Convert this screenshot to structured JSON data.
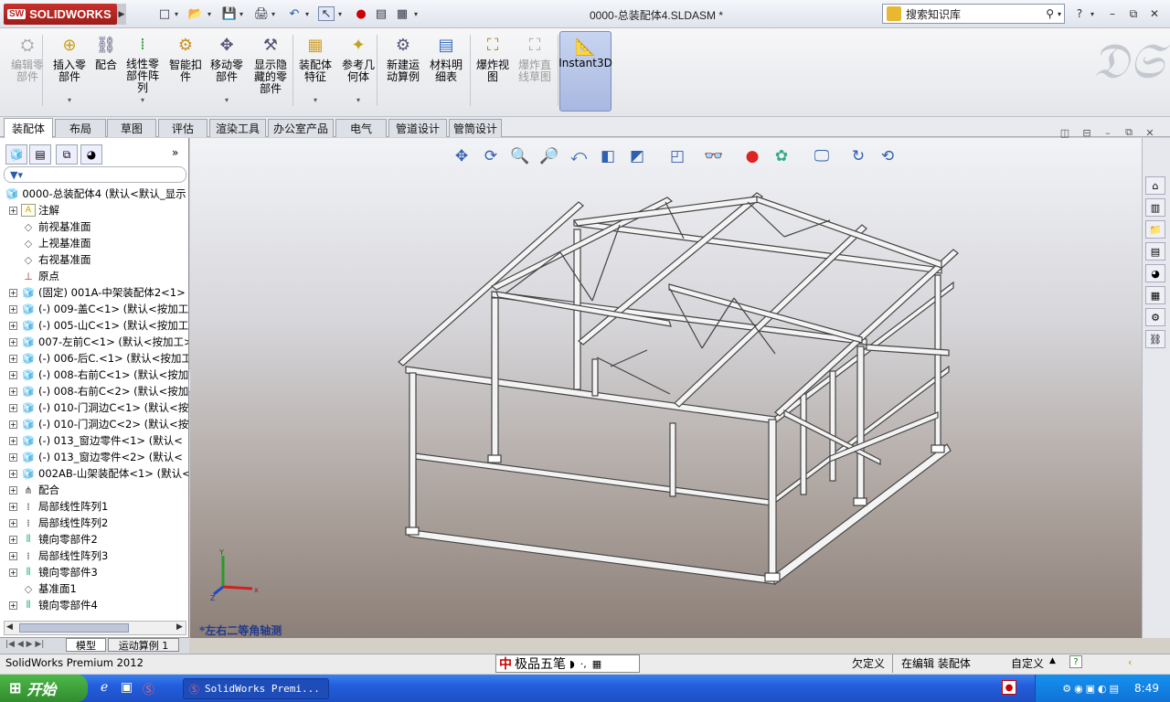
{
  "app": {
    "logo_text": "SOLIDWORKS",
    "logo_badge": "SW",
    "document_title": "0000-总装配体4.SLDASM *"
  },
  "search": {
    "placeholder": "搜索知识库"
  },
  "window_controls": {
    "help": "?",
    "minimize": "–",
    "restore": "⧉",
    "close": "✕"
  },
  "ribbon": {
    "buttons": [
      {
        "label": "编辑零\n部件",
        "enabled": false,
        "icon": "edit-component-icon"
      },
      {
        "label": "插入零\n部件",
        "enabled": true,
        "icon": "insert-component-icon"
      },
      {
        "label": "配合",
        "enabled": true,
        "icon": "mate-icon"
      },
      {
        "label": "线性零\n部件阵\n列",
        "enabled": true,
        "icon": "linear-pattern-icon"
      },
      {
        "label": "智能扣\n件",
        "enabled": true,
        "icon": "smart-fasteners-icon"
      },
      {
        "label": "移动零\n部件",
        "enabled": true,
        "icon": "move-component-icon"
      },
      {
        "label": "显示隐\n藏的零\n部件",
        "enabled": true,
        "icon": "show-hidden-icon"
      },
      {
        "label": "装配体\n特征",
        "enabled": true,
        "icon": "assembly-features-icon"
      },
      {
        "label": "参考几\n何体",
        "enabled": true,
        "icon": "reference-geometry-icon"
      },
      {
        "label": "新建运\n动算例",
        "enabled": true,
        "icon": "new-motion-study-icon"
      },
      {
        "label": "材料明\n细表",
        "enabled": true,
        "icon": "bill-of-materials-icon"
      },
      {
        "label": "爆炸视\n图",
        "enabled": true,
        "icon": "exploded-view-icon"
      },
      {
        "label": "爆炸直\n线草图",
        "enabled": false,
        "icon": "explode-line-sketch-icon"
      }
    ],
    "instant3d": "Instant3D"
  },
  "tabs": [
    "装配体",
    "布局",
    "草图",
    "评估",
    "渲染工具",
    "办公室产品",
    "电气",
    "管道设计",
    "管筒设计"
  ],
  "active_tab": "装配体",
  "tree": {
    "root": "0000-总装配体4  (默认<默认_显示",
    "items": [
      {
        "label": "注解",
        "expand": true,
        "icon": "A"
      },
      {
        "label": "前视基准面",
        "expand": false,
        "icon": "plane"
      },
      {
        "label": "上视基准面",
        "expand": false,
        "icon": "plane"
      },
      {
        "label": "右视基准面",
        "expand": false,
        "icon": "plane"
      },
      {
        "label": "原点",
        "expand": false,
        "icon": "origin"
      },
      {
        "label": "(固定) 001A-中架装配体2<1>",
        "expand": true,
        "icon": "asm"
      },
      {
        "label": "(-) 009-盖C<1> (默认<按加工",
        "expand": true,
        "icon": "part"
      },
      {
        "label": "(-) 005-山C<1> (默认<按加工",
        "expand": true,
        "icon": "part"
      },
      {
        "label": "007-左前C<1> (默认<按加工>",
        "expand": true,
        "icon": "part"
      },
      {
        "label": "(-) 006-后C.<1> (默认<按加工",
        "expand": true,
        "icon": "part"
      },
      {
        "label": "(-) 008-右前C<1> (默认<按加",
        "expand": true,
        "icon": "part"
      },
      {
        "label": "(-) 008-右前C<2> (默认<按加",
        "expand": true,
        "icon": "part"
      },
      {
        "label": "(-) 010-门洞边C<1> (默认<按",
        "expand": true,
        "icon": "part"
      },
      {
        "label": "(-) 010-门洞边C<2> (默认<按",
        "expand": true,
        "icon": "part"
      },
      {
        "label": "(-) 013_窗边零件<1> (默认<",
        "expand": true,
        "icon": "part"
      },
      {
        "label": "(-) 013_窗边零件<2> (默认<",
        "expand": true,
        "icon": "part"
      },
      {
        "label": "002AB-山架装配体<1> (默认<",
        "expand": true,
        "icon": "asm"
      },
      {
        "label": "配合",
        "expand": true,
        "icon": "mates"
      },
      {
        "label": "局部线性阵列1",
        "expand": true,
        "icon": "pattern"
      },
      {
        "label": "局部线性阵列2",
        "expand": true,
        "icon": "pattern"
      },
      {
        "label": "镜向零部件2",
        "expand": true,
        "icon": "mirror"
      },
      {
        "label": "局部线性阵列3",
        "expand": true,
        "icon": "pattern"
      },
      {
        "label": "镜向零部件3",
        "expand": true,
        "icon": "mirror"
      },
      {
        "label": "基准面1",
        "expand": false,
        "icon": "plane"
      },
      {
        "label": "镜向零部件4",
        "expand": true,
        "icon": "mirror"
      }
    ]
  },
  "bottom_tabs": [
    "模型",
    "运动算例 1"
  ],
  "viewport": {
    "view_name": "*左右二等角轴测",
    "triad": {
      "x": "x",
      "y": "Y",
      "z": "Z"
    }
  },
  "status": {
    "app": "SolidWorks Premium 2012",
    "ime": "极品五笔",
    "state1": "欠定义",
    "state2": "在编辑 装配体",
    "custom": "自定义"
  },
  "taskbar": {
    "start": "开始",
    "task": "SolidWorks Premi...",
    "clock": "8:49"
  }
}
